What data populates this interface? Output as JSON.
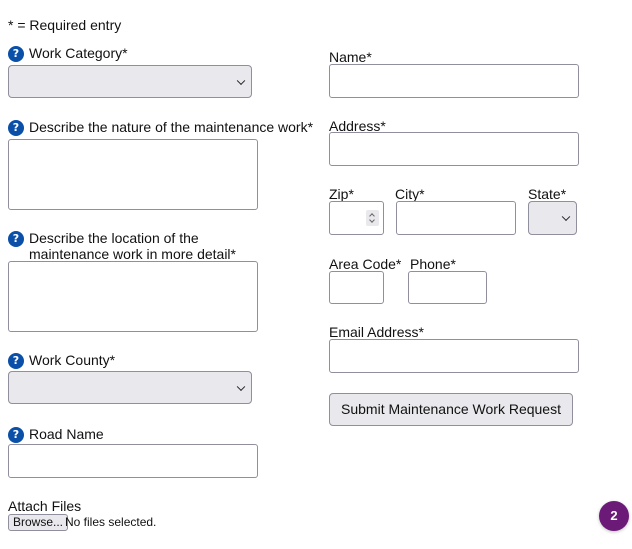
{
  "required_note": "* = Required entry",
  "left": {
    "work_category": {
      "label": "Work Category*",
      "help_icon": "question-circle-icon",
      "value": ""
    },
    "nature": {
      "label": "Describe the nature of the maintenance work*",
      "help_icon": "question-circle-icon",
      "value": ""
    },
    "location": {
      "label": "Describe the location of the maintenance work in more detail*",
      "help_icon": "question-circle-icon",
      "value": ""
    },
    "work_county": {
      "label": "Work County*",
      "help_icon": "question-circle-icon",
      "value": ""
    },
    "road_name": {
      "label": "Road Name",
      "help_icon": "question-circle-icon",
      "value": ""
    },
    "attach": {
      "label": "Attach Files",
      "browse_label": "Browse...",
      "status": "No files selected."
    }
  },
  "right": {
    "name": {
      "label": "Name*",
      "value": ""
    },
    "address": {
      "label": "Address*",
      "value": ""
    },
    "zip": {
      "label": "Zip*",
      "value": ""
    },
    "city": {
      "label": "City*",
      "value": ""
    },
    "state": {
      "label": "State*",
      "value": ""
    },
    "area_code": {
      "label": "Area Code*",
      "value": ""
    },
    "phone": {
      "label": "Phone*",
      "value": ""
    },
    "email": {
      "label": "Email Address*",
      "value": ""
    },
    "submit_label": "Submit Maintenance Work Request"
  },
  "badge": {
    "count": "2",
    "color": "#6b1a78"
  },
  "colors": {
    "help_icon": "#0a4fa8",
    "control_bg": "#e9e9ed",
    "border": "#8f8f9d"
  }
}
